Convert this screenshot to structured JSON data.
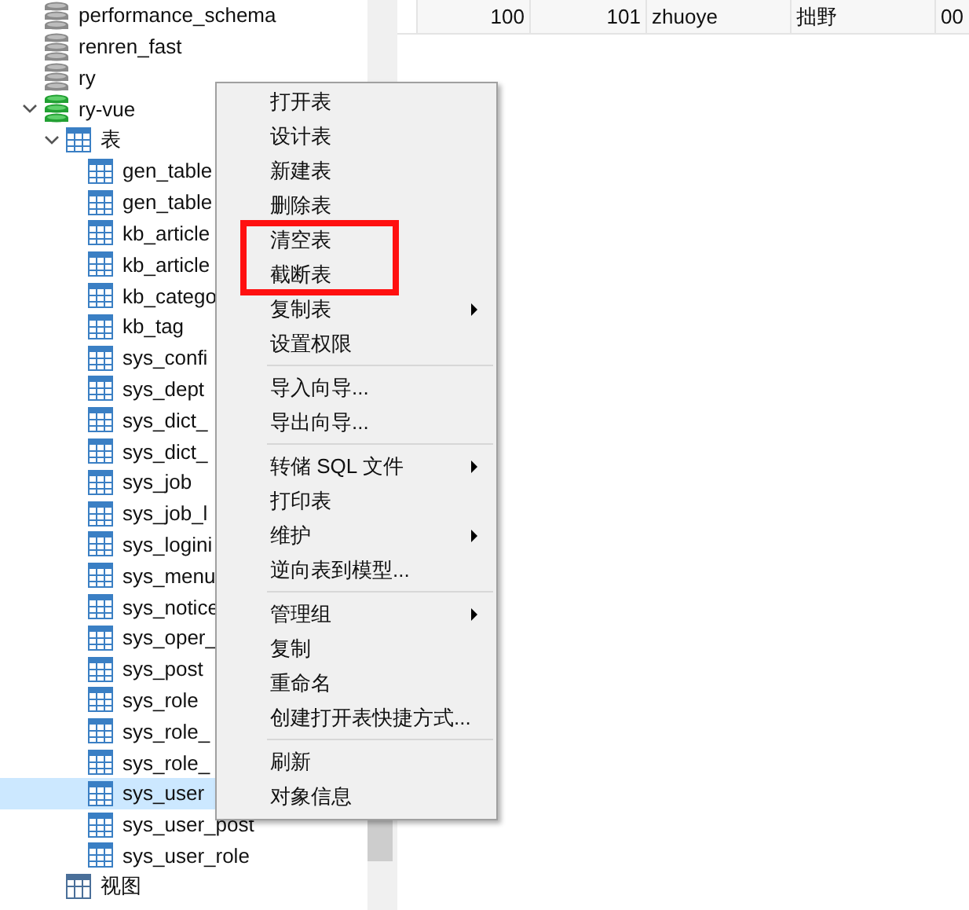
{
  "tree": [
    {
      "kind": "database",
      "label": "performance_schema",
      "active": false
    },
    {
      "kind": "database",
      "label": "renren_fast",
      "active": false
    },
    {
      "kind": "database",
      "label": "ry",
      "active": false
    },
    {
      "kind": "database",
      "label": "ry-vue",
      "active": true,
      "expanded": true,
      "children": [
        {
          "kind": "folder",
          "label": "表",
          "expanded": true,
          "children": [
            {
              "kind": "table",
              "label": "gen_table",
              "selected": false
            },
            {
              "kind": "table",
              "label": "gen_table",
              "selected": false
            },
            {
              "kind": "table",
              "label": "kb_article",
              "selected": false
            },
            {
              "kind": "table",
              "label": "kb_article",
              "selected": false
            },
            {
              "kind": "table",
              "label": "kb_catego",
              "selected": false
            },
            {
              "kind": "table",
              "label": "kb_tag",
              "selected": false
            },
            {
              "kind": "table",
              "label": "sys_confi",
              "selected": false
            },
            {
              "kind": "table",
              "label": "sys_dept",
              "selected": false
            },
            {
              "kind": "table",
              "label": "sys_dict_",
              "selected": false
            },
            {
              "kind": "table",
              "label": "sys_dict_",
              "selected": false
            },
            {
              "kind": "table",
              "label": "sys_job",
              "selected": false
            },
            {
              "kind": "table",
              "label": "sys_job_l",
              "selected": false
            },
            {
              "kind": "table",
              "label": "sys_logini",
              "selected": false
            },
            {
              "kind": "table",
              "label": "sys_menu",
              "selected": false
            },
            {
              "kind": "table",
              "label": "sys_notice",
              "selected": false
            },
            {
              "kind": "table",
              "label": "sys_oper_",
              "selected": false
            },
            {
              "kind": "table",
              "label": "sys_post",
              "selected": false
            },
            {
              "kind": "table",
              "label": "sys_role",
              "selected": false
            },
            {
              "kind": "table",
              "label": "sys_role_",
              "selected": false
            },
            {
              "kind": "table",
              "label": "sys_role_",
              "selected": false
            },
            {
              "kind": "table",
              "label": "sys_user",
              "selected": true
            },
            {
              "kind": "table",
              "label": "sys_user_post",
              "selected": false
            },
            {
              "kind": "table",
              "label": "sys_user_role",
              "selected": false
            }
          ]
        },
        {
          "kind": "view",
          "label": "视图"
        }
      ]
    }
  ],
  "table": {
    "rows": [
      {
        "cells": [
          "100",
          "101",
          "zhuoye",
          "拙野",
          "00"
        ]
      }
    ]
  },
  "context_menu": {
    "items": [
      {
        "kind": "item",
        "label": "打开表",
        "submenu": false,
        "highlighted": false
      },
      {
        "kind": "item",
        "label": "设计表",
        "submenu": false,
        "highlighted": false
      },
      {
        "kind": "item",
        "label": "新建表",
        "submenu": false,
        "highlighted": false
      },
      {
        "kind": "item",
        "label": "删除表",
        "submenu": false,
        "highlighted": false
      },
      {
        "kind": "item",
        "label": "清空表",
        "submenu": false,
        "highlighted": true
      },
      {
        "kind": "item",
        "label": "截断表",
        "submenu": false,
        "highlighted": true
      },
      {
        "kind": "item",
        "label": "复制表",
        "submenu": true,
        "highlighted": false
      },
      {
        "kind": "item",
        "label": "设置权限",
        "submenu": false,
        "highlighted": false
      },
      {
        "kind": "separator"
      },
      {
        "kind": "item",
        "label": "导入向导...",
        "submenu": false,
        "highlighted": false
      },
      {
        "kind": "item",
        "label": "导出向导...",
        "submenu": false,
        "highlighted": false
      },
      {
        "kind": "separator"
      },
      {
        "kind": "item",
        "label": "转储 SQL 文件",
        "submenu": true,
        "highlighted": false
      },
      {
        "kind": "item",
        "label": "打印表",
        "submenu": false,
        "highlighted": false
      },
      {
        "kind": "item",
        "label": "维护",
        "submenu": true,
        "highlighted": false
      },
      {
        "kind": "item",
        "label": "逆向表到模型...",
        "submenu": false,
        "highlighted": false
      },
      {
        "kind": "separator"
      },
      {
        "kind": "item",
        "label": "管理组",
        "submenu": true,
        "highlighted": false
      },
      {
        "kind": "item",
        "label": "复制",
        "submenu": false,
        "highlighted": false
      },
      {
        "kind": "item",
        "label": "重命名",
        "submenu": false,
        "highlighted": false
      },
      {
        "kind": "item",
        "label": "创建打开表快捷方式...",
        "submenu": false,
        "highlighted": false
      },
      {
        "kind": "separator"
      },
      {
        "kind": "item",
        "label": "刷新",
        "submenu": false,
        "highlighted": false
      },
      {
        "kind": "item",
        "label": "对象信息",
        "submenu": false,
        "highlighted": false
      }
    ]
  }
}
